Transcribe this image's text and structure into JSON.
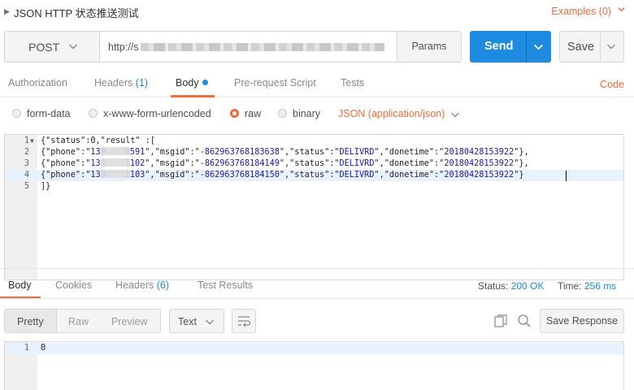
{
  "header": {
    "title": "JSON HTTP 状态推送测试",
    "examples_label": "Examples (0)"
  },
  "request": {
    "method": "POST",
    "url_prefix": "http://s",
    "params_label": "Params",
    "send_label": "Send",
    "save_label": "Save"
  },
  "request_tabs": {
    "authorization": "Authorization",
    "headers": "Headers",
    "headers_count": "(1)",
    "body": "Body",
    "prerequest": "Pre-request Script",
    "tests": "Tests",
    "code": "Code"
  },
  "body_types": {
    "form_data": "form-data",
    "urlencoded": "x-www-form-urlencoded",
    "raw": "raw",
    "binary": "binary",
    "content_type": "JSON (application/json)",
    "selected": "raw"
  },
  "request_body": {
    "line_numbers": [
      "1",
      "2",
      "3",
      "4",
      "5"
    ],
    "line1": "{\"status\":0,\"result\" :[",
    "rows": [
      {
        "phone_prefix": "139",
        "phone_suffix": "0591",
        "msgid": "-862963768183638",
        "status": "DELIVRD",
        "donetime": "20180428153922",
        "tail": "},"
      },
      {
        "phone_prefix": "139",
        "phone_suffix": "1102",
        "msgid": "-862963768184149",
        "status": "DELIVRD",
        "donetime": "20180428153922",
        "tail": "},"
      },
      {
        "phone_prefix": "139",
        "phone_suffix": "1103",
        "msgid": "-862963768184150",
        "status": "DELIVRD",
        "donetime": "20180428153922",
        "tail": "}"
      }
    ],
    "line5": "]}"
  },
  "response_tabs": {
    "body": "Body",
    "cookies": "Cookies",
    "headers": "Headers",
    "headers_count": "(6)",
    "test_results": "Test Results",
    "status_label": "Status:",
    "status_value": "200 OK",
    "time_label": "Time:",
    "time_value": "256 ms"
  },
  "response_toolbar": {
    "pretty": "Pretty",
    "raw": "Raw",
    "preview": "Preview",
    "format": "Text",
    "save_response": "Save Response"
  },
  "response_body": {
    "line_number": "1",
    "content": "0"
  },
  "colors": {
    "accent": "#f26b3a",
    "primary": "#1d8ce0"
  }
}
